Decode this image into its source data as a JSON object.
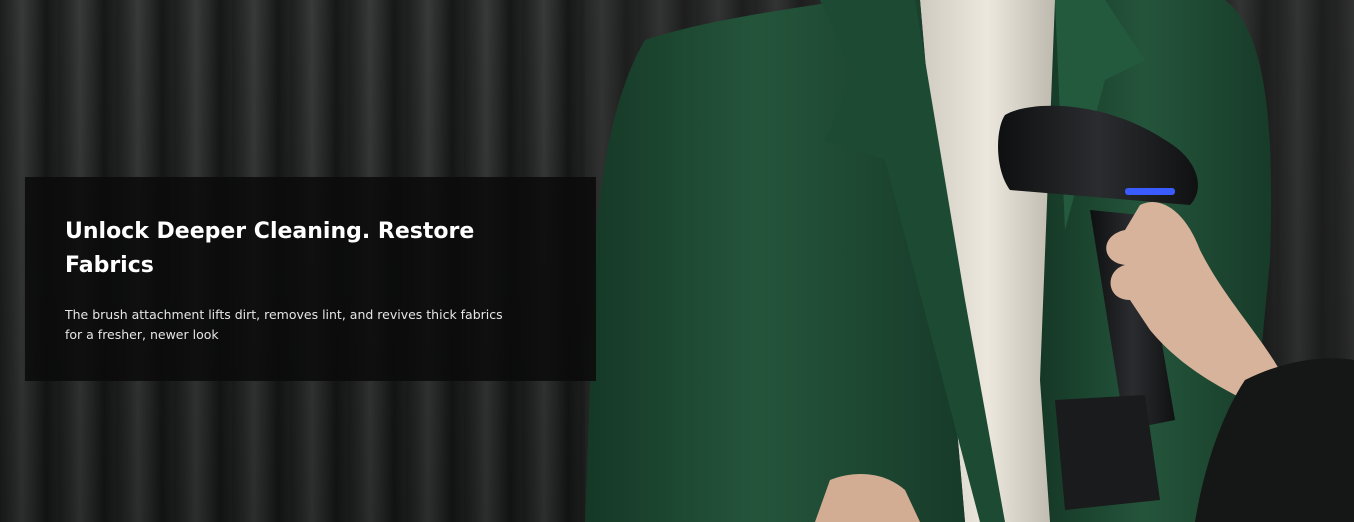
{
  "hero": {
    "headline": "Unlock Deeper Cleaning. Restore Fabrics",
    "description": "The brush attachment lifts dirt, removes lint, and revives thick fabrics for a fresher, newer look"
  },
  "colors": {
    "panel_background": "#0a0a0a",
    "jacket_green": "#1f4a33",
    "steamer_body": "#1c1d1f",
    "steamer_indicator": "#3a5cff",
    "curtain": "#2a2b2b"
  },
  "icons": {
    "product": "garment-steamer-icon"
  }
}
